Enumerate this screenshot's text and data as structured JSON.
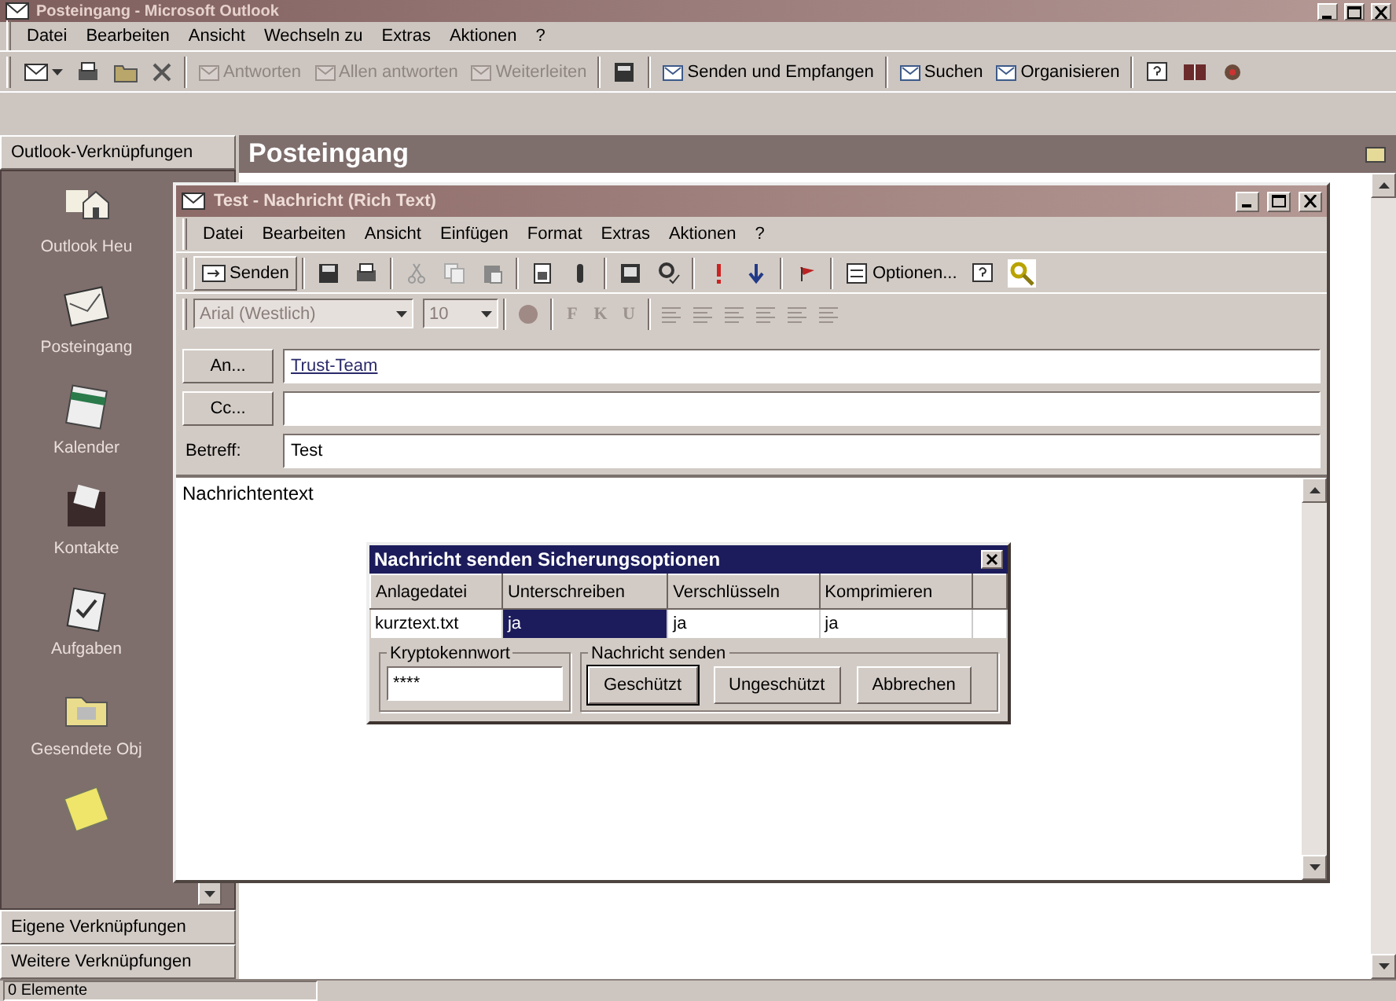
{
  "main_window": {
    "title": "Posteingang - Microsoft Outlook",
    "menu": [
      "Datei",
      "Bearbeiten",
      "Ansicht",
      "Wechseln zu",
      "Extras",
      "Aktionen",
      "?"
    ],
    "toolbar": [
      {
        "label": "Antworten",
        "disabled": true
      },
      {
        "label": "Allen antworten",
        "disabled": true
      },
      {
        "label": "Weiterleiten",
        "disabled": true
      },
      {
        "label": "Senden und Empfangen",
        "disabled": false
      },
      {
        "label": "Suchen",
        "disabled": false
      },
      {
        "label": "Organisieren",
        "disabled": false
      }
    ],
    "shortcuts_header": "Outlook-Verknüpfungen",
    "shortcuts": [
      "Outlook Heu",
      "Posteingang",
      "Kalender",
      "Kontakte",
      "Aufgaben",
      "Gesendete Obj"
    ],
    "shortcut_groups": [
      "Eigene Verknüpfungen",
      "Weitere Verknüpfungen"
    ],
    "folder_title": "Posteingang",
    "status_bar": "0 Elemente"
  },
  "message_window": {
    "title": "Test - Nachricht (Rich Text)",
    "menu": [
      "Datei",
      "Bearbeiten",
      "Ansicht",
      "Einfügen",
      "Format",
      "Extras",
      "Aktionen",
      "?"
    ],
    "send_button": "Senden",
    "options_button": "Optionen...",
    "font": "Arial (Westlich)",
    "font_size": "10",
    "format_buttons": [
      {
        "label": "F",
        "disabled": true
      },
      {
        "label": "K",
        "disabled": true
      },
      {
        "label": "U",
        "disabled": true
      }
    ],
    "fields": [
      {
        "kind": "button",
        "label": "An...",
        "value": "Trust-Team",
        "resolved": true
      },
      {
        "kind": "button",
        "label": "Cc..."
      },
      {
        "kind": "label",
        "label": "Betreff:",
        "value": "Test"
      }
    ],
    "body": "Nachrichtentext"
  },
  "dialog": {
    "title": "Nachricht senden Sicherungsoptionen",
    "columns": [
      "Anlagedatei",
      "Unterschreiben",
      "Verschlüsseln",
      "Komprimieren"
    ],
    "rows": [
      {
        "cells": [
          {
            "text": "kurztext.txt",
            "selected": false
          },
          {
            "text": "ja",
            "selected": true
          },
          {
            "text": "ja",
            "selected": false
          },
          {
            "text": "ja",
            "selected": false
          }
        ]
      }
    ],
    "password_group": "Kryptokennwort",
    "password": "****",
    "send_group": "Nachricht senden",
    "buttons": [
      {
        "label": "Geschützt",
        "default": true
      },
      {
        "label": "Ungeschützt",
        "default": false
      },
      {
        "label": "Abbrechen",
        "default": false
      }
    ]
  }
}
